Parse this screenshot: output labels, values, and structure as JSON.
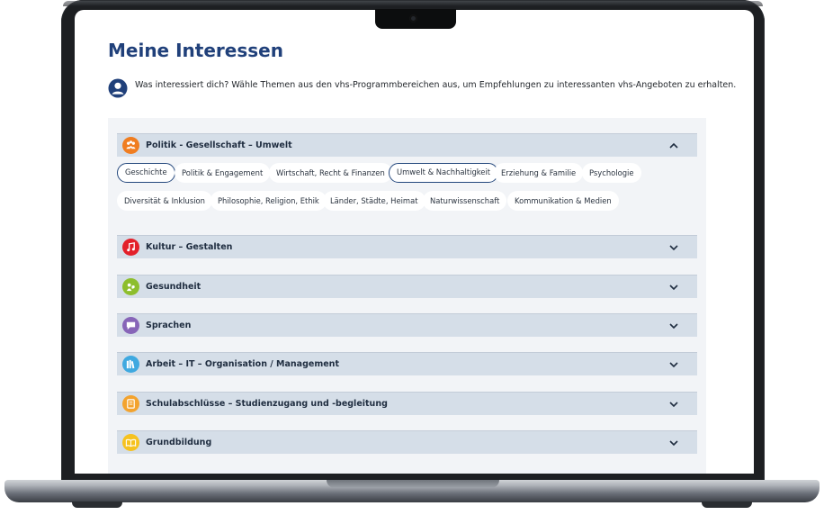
{
  "page": {
    "title": "Meine Interessen",
    "intro": "Was interessiert dich? Wähle Themen aus den vhs-Programmbereichen aus, um Empfehlungen zu interessanten vhs-Angeboten zu erhalten."
  },
  "categories": [
    {
      "label": "Politik - Gesellschaft – Umwelt",
      "icon": "people-icon",
      "color": "#f07d20",
      "expanded": true,
      "topics": [
        {
          "label": "Geschichte",
          "selected": true
        },
        {
          "label": "Politik & Engagement",
          "selected": false
        },
        {
          "label": "Wirtschaft, Recht & Finanzen",
          "selected": false
        },
        {
          "label": "Umwelt & Nachhaltigkeit",
          "selected": true
        },
        {
          "label": "Erziehung & Familie",
          "selected": false
        },
        {
          "label": "Psychologie",
          "selected": false
        },
        {
          "label": "Diversität & Inklusion",
          "selected": false
        },
        {
          "label": "Philosophie, Religion, Ethik",
          "selected": false
        },
        {
          "label": "Länder, Städte, Heimat",
          "selected": false
        },
        {
          "label": "Naturwissenschaft",
          "selected": false
        },
        {
          "label": "Kommunikation & Medien",
          "selected": false
        }
      ]
    },
    {
      "label": "Kultur – Gestalten",
      "icon": "music-icon",
      "color": "#e3202a",
      "expanded": false
    },
    {
      "label": "Gesundheit",
      "icon": "health-icon",
      "color": "#8dbe2c",
      "expanded": false
    },
    {
      "label": "Sprachen",
      "icon": "speech-icon",
      "color": "#8765b8",
      "expanded": false
    },
    {
      "label": "Arbeit – IT – Organisation / Management",
      "icon": "books-icon",
      "color": "#3fa9e0",
      "expanded": false
    },
    {
      "label": "Schulabschlüsse – Studienzugang und -begleitung",
      "icon": "certificate-icon",
      "color": "#f3a32e",
      "expanded": false
    },
    {
      "label": "Grundbildung",
      "icon": "book-icon",
      "color": "#f6c21f",
      "expanded": false
    }
  ]
}
